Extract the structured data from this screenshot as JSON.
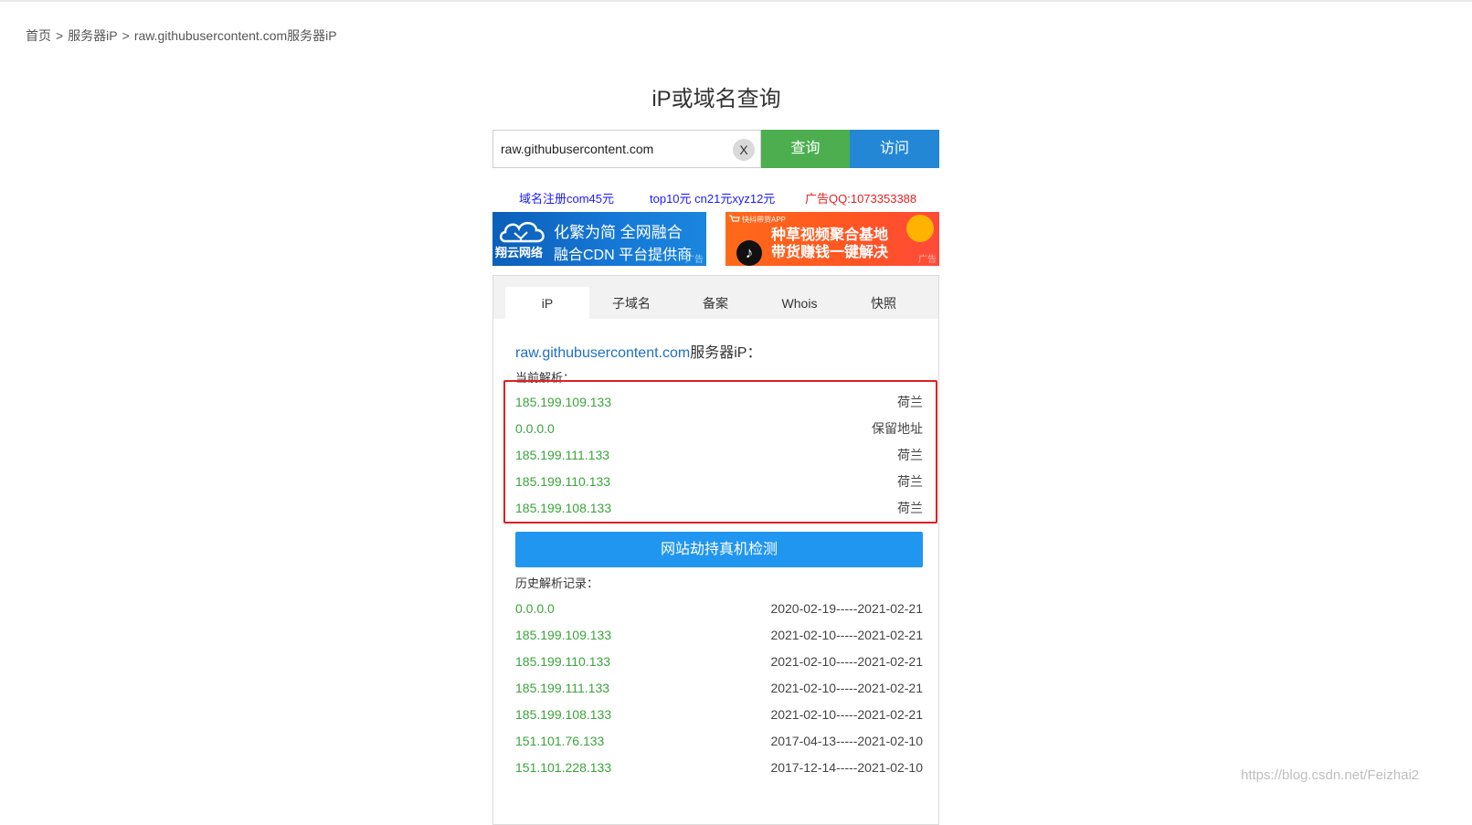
{
  "breadcrumb": {
    "home": "首页",
    "separator": ">",
    "section": "服务器iP",
    "current": "raw.githubusercontent.com服务器iP"
  },
  "page_title": "iP或域名查询",
  "search": {
    "value": "raw.githubusercontent.com",
    "clear_label": "X",
    "query_button": "查询",
    "visit_button": "访问"
  },
  "ad_links": [
    {
      "text": "域名注册com45元",
      "color": "#1a1aff"
    },
    {
      "text": "top10元 cn21元xyz12元",
      "color": "#1a1aff"
    },
    {
      "text": "广告QQ:1073353388",
      "color": "#e52222"
    }
  ],
  "banners": {
    "left": {
      "brand": "翔云网络",
      "line1": "化繁为简   全网融合",
      "line2": "融合CDN 平台提供商",
      "ad_tag": "广告"
    },
    "right": {
      "small": "快抖带货APP",
      "line1": "种草视频聚合基地",
      "line2": "带货赚钱一键解决",
      "ad_tag": "广告"
    }
  },
  "tabs": [
    {
      "label": "iP",
      "active": true
    },
    {
      "label": "子域名",
      "active": false
    },
    {
      "label": "备案",
      "active": false
    },
    {
      "label": "Whois",
      "active": false
    },
    {
      "label": "快照",
      "active": false
    }
  ],
  "result": {
    "domain": "raw.githubusercontent.com",
    "suffix": "服务器iP：",
    "current_label": "当前解析：",
    "current": [
      {
        "ip": "185.199.109.133",
        "location": "荷兰"
      },
      {
        "ip": "0.0.0.0",
        "location": "保留地址"
      },
      {
        "ip": "185.199.111.133",
        "location": "荷兰"
      },
      {
        "ip": "185.199.110.133",
        "location": "荷兰"
      },
      {
        "ip": "185.199.108.133",
        "location": "荷兰"
      }
    ],
    "hijack_button": "网站劫持真机检测",
    "history_label": "历史解析记录：",
    "history": [
      {
        "ip": "0.0.0.0",
        "range": "2020-02-19-----2021-02-21"
      },
      {
        "ip": "185.199.109.133",
        "range": "2021-02-10-----2021-02-21"
      },
      {
        "ip": "185.199.110.133",
        "range": "2021-02-10-----2021-02-21"
      },
      {
        "ip": "185.199.111.133",
        "range": "2021-02-10-----2021-02-21"
      },
      {
        "ip": "185.199.108.133",
        "range": "2021-02-10-----2021-02-21"
      },
      {
        "ip": "151.101.76.133",
        "range": "2017-04-13-----2021-02-10"
      },
      {
        "ip": "151.101.228.133",
        "range": "2017-12-14-----2021-02-10"
      }
    ]
  },
  "watermark": "https://blog.csdn.net/Feizhai2",
  "colors": {
    "query_green": "#4cae4f",
    "visit_blue": "#2487d6",
    "ip_green": "#3aa53a",
    "highlight_red": "#e02020",
    "hijack_blue": "#2196f0"
  }
}
